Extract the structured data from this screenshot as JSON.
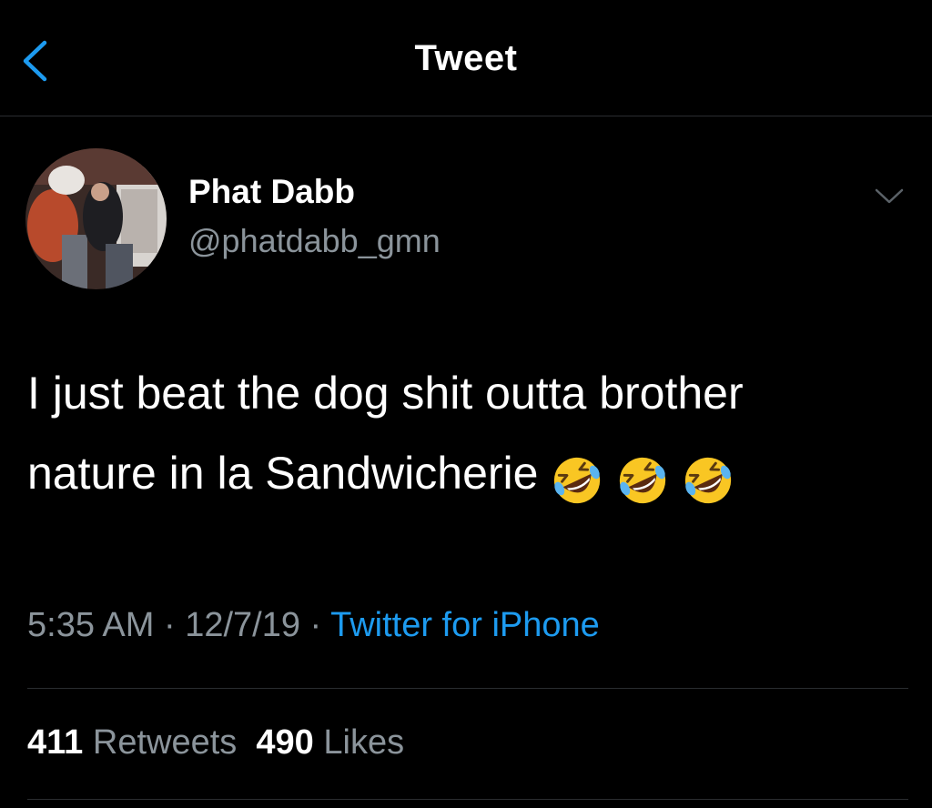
{
  "nav": {
    "title": "Tweet",
    "back_icon": "chevron-left-icon",
    "accent_color": "#1d9bf0"
  },
  "author": {
    "display_name": "Phat Dabb",
    "handle": "@phatdabb_gmn",
    "more_icon": "chevron-down-icon"
  },
  "tweet": {
    "line1": "I just beat the dog shit outta brother",
    "line2": "nature in la Sandwicherie",
    "emoji": [
      "rolling-on-floor-laughing-emoji",
      "rolling-on-floor-laughing-emoji",
      "rolling-on-floor-laughing-emoji"
    ]
  },
  "meta": {
    "time": "5:35 AM",
    "sep1": " · ",
    "date": "12/7/19",
    "sep2": " · ",
    "source": "Twitter for iPhone"
  },
  "stats": {
    "retweets_count": "411",
    "retweets_label": "Retweets",
    "likes_count": "490",
    "likes_label": "Likes"
  },
  "colors": {
    "background": "#000000",
    "text_primary": "#ffffff",
    "text_secondary": "#8b949b",
    "link": "#1d9bf0",
    "divider": "#2a2d30"
  }
}
